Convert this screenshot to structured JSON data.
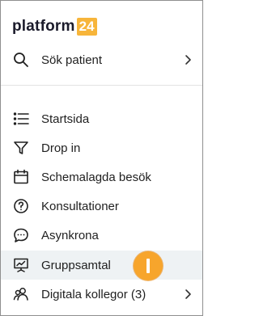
{
  "brand": {
    "name": "platform",
    "badge": "24",
    "badge_color": "#f7b53a"
  },
  "search": {
    "label": "Sök patient",
    "icon": "search-icon"
  },
  "nav": {
    "items": [
      {
        "label": "Startsida",
        "icon": "list-icon",
        "active": false,
        "has_submenu": false
      },
      {
        "label": "Drop in",
        "icon": "funnel-icon",
        "active": false,
        "has_submenu": false
      },
      {
        "label": "Schemalagda besök",
        "icon": "calendar-icon",
        "active": false,
        "has_submenu": false
      },
      {
        "label": "Konsultationer",
        "icon": "question-circle-icon",
        "active": false,
        "has_submenu": false
      },
      {
        "label": "Asynkrona",
        "icon": "chat-bubble-icon",
        "active": false,
        "has_submenu": false
      },
      {
        "label": "Gruppsamtal",
        "icon": "presentation-screen-icon",
        "active": true,
        "has_submenu": false
      },
      {
        "label": "Digitala kollegor (3)",
        "icon": "people-icon",
        "active": false,
        "has_submenu": true
      }
    ]
  },
  "colors": {
    "active_background": "#eef2f4",
    "cursor_marker": "#f7a52c"
  }
}
